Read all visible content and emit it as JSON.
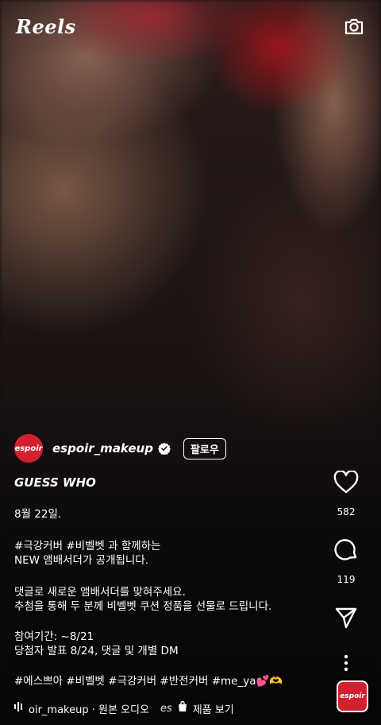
{
  "header": {
    "title": "Reels",
    "camera_icon": "camera-icon"
  },
  "author": {
    "avatar_text": "espoir",
    "username": "espoir_makeup",
    "verified_icon": "verified-badge-icon",
    "follow_label": "팔로우",
    "brand_color": "#d32030"
  },
  "caption": {
    "title": "GUESS WHO",
    "date": "8월 22일.",
    "intro": "#극강커버 #비벨벳 과 함께하는\nNEW 앰배서더가 공개됩니다.",
    "cta": "댓글로 새로운 앰배서더를 맞혀주세요.\n추첨을 통해 두 분께 비벨벳 쿠션 정품을 선물로 드립니다.",
    "period": "참여기간: ~8/21\n당첨자 발표 8/24, 댓글 및 개별 DM",
    "hashtags": "#에스쁘아 #비벨벳 #극강커버 #반전커버 #me_ya💕🫶"
  },
  "audio": {
    "icon": "audio-bars-icon",
    "track": "oir_makeup · 원본 오디오",
    "product_prefix": "es",
    "shop_icon": "shopping-bag-icon",
    "product_label": "제품 보기"
  },
  "actions": {
    "like_icon": "heart-icon",
    "like_count": "582",
    "comment_icon": "comment-icon",
    "comment_count": "119",
    "share_icon": "send-icon",
    "more_icon": "more-vertical-icon"
  },
  "thumbnail": {
    "text": "espoir"
  }
}
